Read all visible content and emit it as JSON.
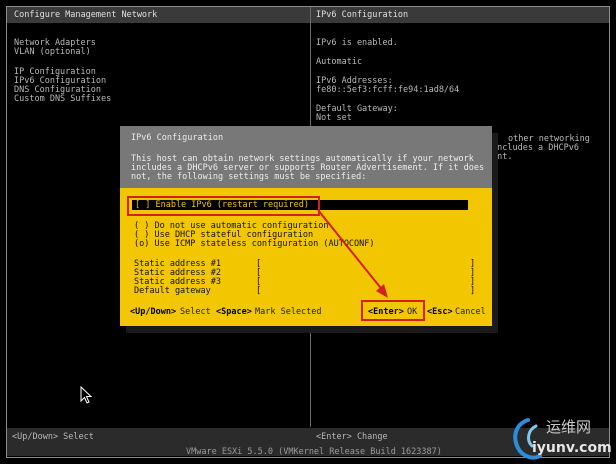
{
  "screen": {
    "left_title": "Configure Management Network",
    "right_title": "IPv6 Configuration",
    "menu": [
      "Network Adapters",
      "VLAN (optional)",
      "IP Configuration",
      "IPv6 Configuration",
      "DNS Configuration",
      "Custom DNS Suffixes"
    ],
    "info": {
      "status": "IPv6 is enabled.",
      "mode": "Automatic",
      "addresses_label": "IPv6 Addresses:",
      "address_1": "fe80::5ef3:fcff:fe94:1ad8/64",
      "gateway_label": "Default Gateway:",
      "gateway_value": "Not set",
      "partial_1": "other networking",
      "partial_2": "includes a DHCPv6",
      "partial_3": "ent."
    },
    "bottom_left": "<Up/Down> Select",
    "bottom_right": "<Enter> Change",
    "footer": "VMware ESXi 5.5.0 (VMKernel Release Build 1623387)"
  },
  "dialog": {
    "title": "IPv6 Configuration",
    "description": [
      "This host can obtain network settings automatically if your network",
      "includes a DHCPv6 server or supports Router Advertisement. If it does",
      "not, the following settings must be specified:"
    ],
    "enable_option": "[ ] Enable IPv6 (restart required)",
    "options": [
      "( ) Do not use automatic configuration",
      "( ) Use DHCP stateful configuration",
      "(o) Use ICMP stateless configuration (AUTOCONF)"
    ],
    "fields": [
      {
        "label": "Static address #1",
        "value": "["
      },
      {
        "label": "Static address #2",
        "value": "["
      },
      {
        "label": "Static address #3",
        "value": "["
      },
      {
        "label": "Default gateway",
        "value": "["
      }
    ],
    "field_close": "]",
    "keys": {
      "updown": "<Up/Down>",
      "select": "Select",
      "space": "<Space>",
      "mark": "Mark Selected",
      "enter": "<Enter>",
      "ok": "OK",
      "esc": "<Esc>",
      "cancel": "Cancel"
    }
  },
  "watermark": {
    "text_cn": "运维网",
    "text_en": "iyunv.com"
  },
  "colors": {
    "dialog_bg": "#f2c600",
    "dialog_title_bg": "#787878",
    "annotation": "#d32020"
  }
}
